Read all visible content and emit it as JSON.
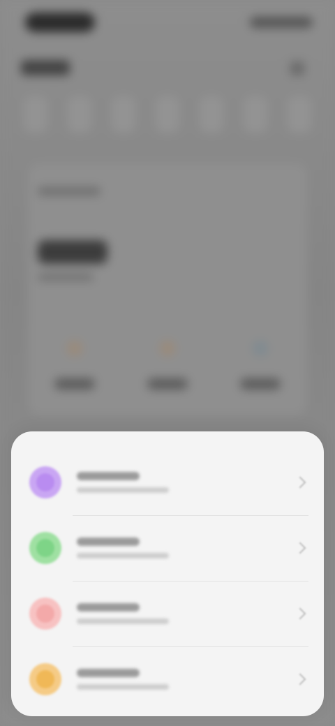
{
  "colors": {
    "backdrop": "#8a8a8a",
    "sheet": "#f4f4f4",
    "divider": "#e2e2e2",
    "purple": "#c9a6f3",
    "green": "#9fe0a2",
    "pink": "#f7c2c2",
    "orange": "#f5cb86"
  },
  "sheet": {
    "items": [
      {
        "icon": "purple-circle-icon",
        "color": "#c9a6f3",
        "glyph": "#b98cf0"
      },
      {
        "icon": "green-circle-icon",
        "color": "#9fe0a2",
        "glyph": "#7ed487"
      },
      {
        "icon": "pink-circle-icon",
        "color": "#f7c2c2",
        "glyph": "#f3a9a9"
      },
      {
        "icon": "orange-circle-icon",
        "color": "#f5cb86",
        "glyph": "#f0b857"
      }
    ]
  }
}
